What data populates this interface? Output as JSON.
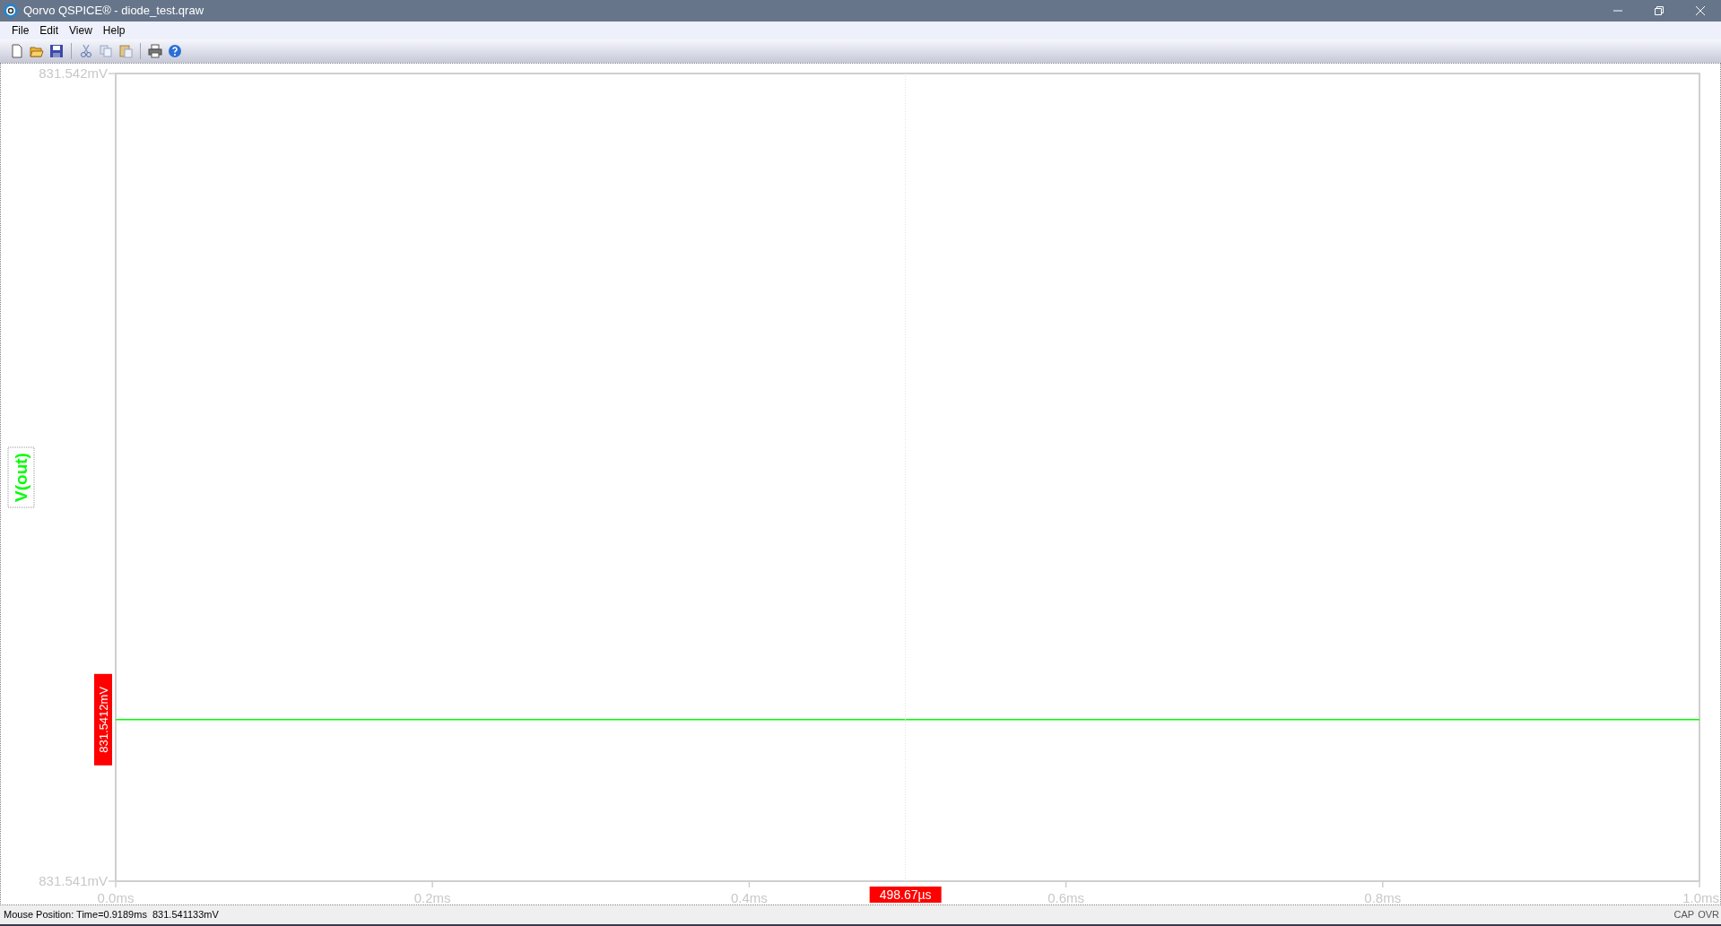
{
  "window": {
    "title": "Qorvo QSPICE® - diode_test.qraw"
  },
  "menu": [
    "File",
    "Edit",
    "View",
    "Help"
  ],
  "plot": {
    "cursor_value_label": "831.5412mV",
    "chart_data": {
      "type": "line",
      "x": [
        0,
        1.0
      ],
      "series": [
        {
          "name": "V(out)",
          "color": "#00ff00",
          "values": [
            831.5412,
            831.5412
          ]
        }
      ],
      "xlim": [
        0,
        1.0
      ],
      "ylim": [
        831.541,
        831.542
      ],
      "xticks": [
        {
          "value": 0,
          "label": "0.0ms"
        },
        {
          "value": 0.2,
          "label": "0.2ms"
        },
        {
          "value": 0.4,
          "label": "0.4ms"
        },
        {
          "value": 0.6,
          "label": "0.6ms"
        },
        {
          "value": 0.8,
          "label": "0.8ms"
        },
        {
          "value": 1.0,
          "label": "1.0ms"
        }
      ],
      "yticks": [
        {
          "value": 831.541,
          "label": "831.541mV"
        },
        {
          "value": 831.542,
          "label": "831.542mV"
        }
      ],
      "ref_lines": [
        {
          "axis": "x",
          "value": 0.49867,
          "label": "498.67µs"
        }
      ]
    }
  },
  "status_bar": {
    "mouse_position": "Mouse Position: Time=0.9189ms  831.541133mV",
    "indicators": [
      "CAP",
      "OVR"
    ]
  }
}
